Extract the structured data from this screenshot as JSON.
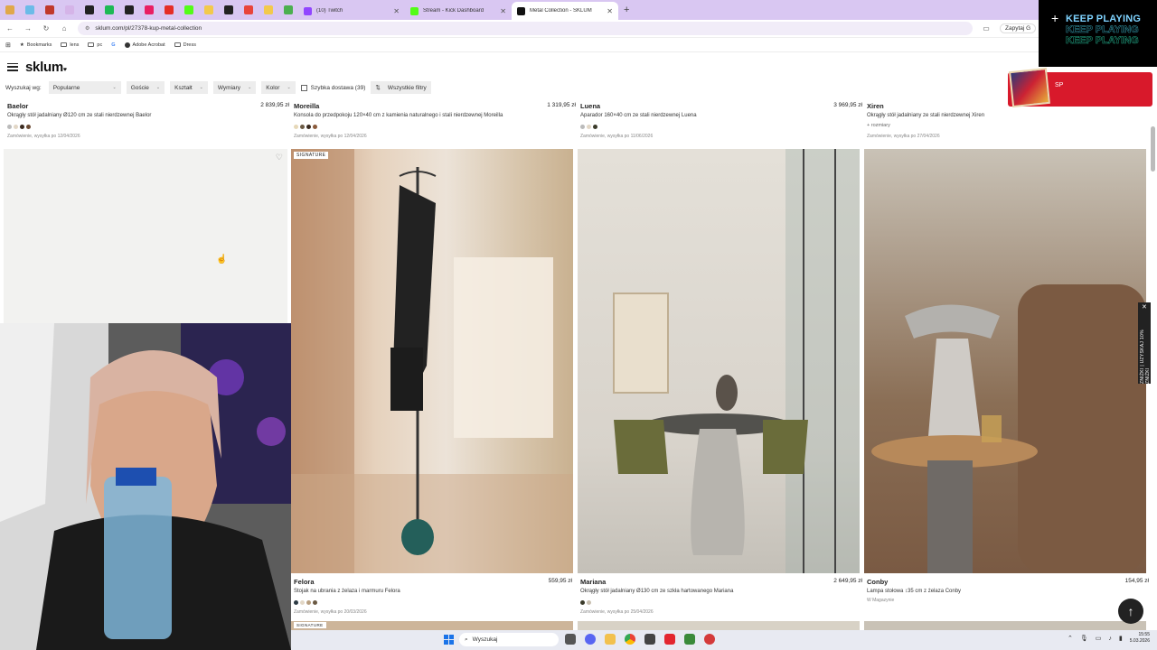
{
  "browser": {
    "pinned_tab_colors": [
      "#e0a84a",
      "#6bbbe8",
      "#c0392b",
      "#d5b4e8",
      "#222222",
      "#1db954",
      "#222222",
      "#e91e63",
      "#e52d27",
      "#53fc18",
      "#f2c94c",
      "#222222",
      "#e8443a",
      "#f2c94c",
      "#4caf50"
    ],
    "tabs": [
      {
        "title": "(10) Twitch",
        "fav_color": "#9146ff"
      },
      {
        "title": "Stream - Kick Dashboard",
        "fav_color": "#53fc18"
      },
      {
        "title": "Metal Collection - SKLUM",
        "fav_color": "#111111"
      }
    ],
    "new_tab": "+",
    "url": "sklum.com/pl/27378-kup-metal-collection",
    "ask_label": "Zapytaj G",
    "bookmarks": [
      "Bookmarks",
      "lens",
      "pc",
      "G",
      "Adobe Acrobat",
      "Dress"
    ]
  },
  "site": {
    "logo": "sklum",
    "logo_mark": "♥",
    "filters": {
      "label": "Wyszukaj wg:",
      "sort": "Popularne",
      "options": [
        "Goście",
        "Kształt",
        "Wymiary",
        "Kolor"
      ],
      "fast_delivery": "Szybka dostawa (39)",
      "all_filters": "Wszystkie filtry"
    }
  },
  "products_top": [
    {
      "name": "Baelor",
      "price": "2 839,95 zł",
      "desc": "Okrągły stół jadalniany Ø120 cm ze stali nierdzewnej Baelor",
      "swatches": [
        "#bbbbbb",
        "#e2d7c6",
        "#3a2a1f",
        "#6b4b34"
      ],
      "delivery": "Zamówienie, wysyłka po 12/04/2026"
    },
    {
      "name": "Moreilla",
      "price": "1 319,95 zł",
      "desc": "Konsola do przedpokoju 120×40 cm z kamienia naturalnego i stali nierdzewnej Moreilla",
      "swatches": [
        "#e6d8b8",
        "#6b5a44",
        "#3a2a1f",
        "#8a5a3a"
      ],
      "delivery": "Zamówienie, wysyłka po 12/04/2026"
    },
    {
      "name": "Luena",
      "price": "3 969,95 zł",
      "desc": "Aparador 160×40 cm ze stali nierdzewnej Luena",
      "swatches": [
        "#bbbbbb",
        "#e2d7c6",
        "#3b3b2a"
      ],
      "delivery": "Zamówienie, wysyłka po 11/06/2026"
    },
    {
      "name": "Xiren",
      "price": "",
      "desc": "Okrągły stół jadalniany ze stali nierdzewnej Xiren",
      "extra": "+ rozmiary",
      "swatches": [],
      "delivery": "Zamówienie, wysyłka po 27/04/2026"
    }
  ],
  "tile_badges": {
    "signature": "SIGNATURE"
  },
  "products_bottom": [
    {
      "name": "Felora",
      "price": "559,95 zł",
      "desc": "Stojak na ubrania z żelaza i marmuru Felora",
      "swatches": [
        "#2c3a44",
        "#e2d7c6",
        "#b89f80",
        "#6b5a44"
      ],
      "delivery": "Zamówienie, wysyłka po 20/03/2026"
    },
    {
      "name": "Mariana",
      "price": "2 649,95 zł",
      "desc": "Okrągły stół jadalniany Ø130 cm ze szkła hartowanego Mariana",
      "swatches": [
        "#3b3b2a",
        "#c9c0b0"
      ],
      "delivery": "Zamówienie, wysyłka po 25/04/2026"
    },
    {
      "name": "Conby",
      "price": "154,95 zł",
      "desc": "Lampa stołowa ↕35 cm z żelaza Conby",
      "swatches": [],
      "delivery": "W Magazynie"
    }
  ],
  "overlays": {
    "keep_playing": "KEEP PLAYING",
    "sp_label": "SP",
    "side_tab": "ZNIŻKI | UZYSKAJ 10% ZNIŻKI",
    "scroll_up": "↑"
  },
  "taskbar": {
    "search": "Wyszukaj",
    "time": "15:55",
    "date": "5.03.2026"
  }
}
